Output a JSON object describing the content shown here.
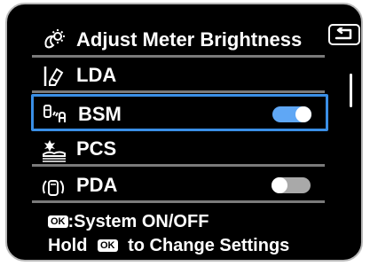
{
  "menu": {
    "items": [
      {
        "label": "Adjust Meter Brightness",
        "icon": "brightness-icon",
        "toggle": null
      },
      {
        "label": "LDA",
        "icon": "lda-icon",
        "toggle": null
      },
      {
        "label": "BSM",
        "icon": "bsm-icon",
        "toggle": "on",
        "selected": true
      },
      {
        "label": "PCS",
        "icon": "pcs-icon",
        "toggle": null
      },
      {
        "label": "PDA",
        "icon": "pda-icon",
        "toggle": "off"
      }
    ]
  },
  "footer": {
    "ok_chip": "OK",
    "line1_text": ":System ON/OFF",
    "line2_prefix": "Hold",
    "line2_suffix": "to Change Settings"
  },
  "colors": {
    "background": "#000000",
    "selection": "#3a8fe6",
    "toggle_on": "#5fa7f5",
    "toggle_off": "#a9a9a9",
    "divider": "#7a7a7a"
  },
  "scroll": {
    "position_fraction": 0.15
  }
}
